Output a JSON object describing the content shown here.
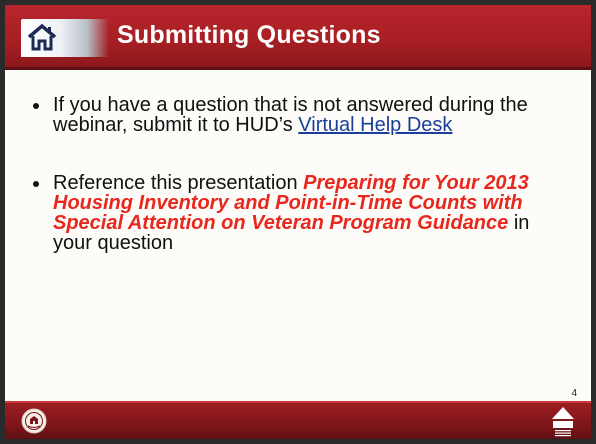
{
  "slide": {
    "title": "Submitting Questions",
    "page_number": "4",
    "bullets": [
      {
        "text_before": "If you have a question that is not answered during the webinar, submit it to HUD’s ",
        "link_text": "Virtual Help Desk"
      },
      {
        "text_before": "Reference this presentation ",
        "emphasis": "Preparing for Your 2013 Housing Inventory and Point-in-Time Counts with Special Attention on Veteran Program Guidance",
        "text_after": " in your question"
      }
    ]
  },
  "icons": {
    "title_icon": "house-icon",
    "left_footer": "hud-seal-icon",
    "right_footer": "community-planning-development-logo"
  },
  "colors": {
    "title_bar": "#a81f24",
    "emphasis": "#e8271d",
    "link": "#1a3f9a",
    "footer_bar": "#7d151a"
  }
}
